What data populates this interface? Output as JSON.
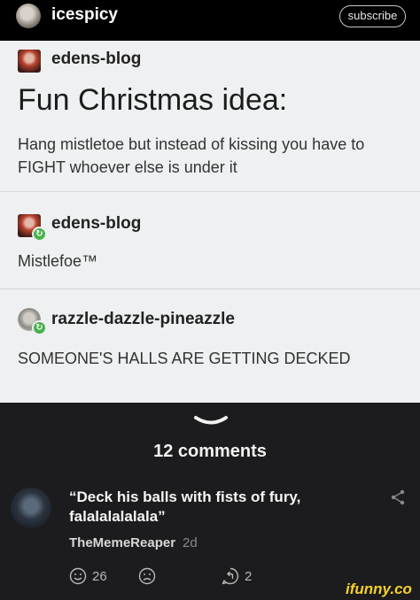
{
  "header": {
    "username": "icespicy",
    "subscribe_label": "subscribe"
  },
  "post": {
    "op_blog": "edens-blog",
    "title": "Fun Christmas idea:",
    "body": "Hang mistletoe but instead of kissing you have to FIGHT whoever else is under it",
    "reblogs": [
      {
        "blog": "edens-blog",
        "text": "Mistlefoe™"
      },
      {
        "blog": "razzle-dazzle-pineazzle",
        "text": "SOMEONE'S HALLS ARE GETTING DECKED"
      }
    ]
  },
  "comments": {
    "count_label": "12 comments",
    "top_comment": {
      "text": "“Deck his balls with fists of fury, falalalalalala”",
      "author": "TheMemeReaper",
      "time": "2d",
      "smile_count": "26",
      "reply_count": "2"
    }
  },
  "watermark": "ifunny.co",
  "icons": {
    "smile": "smile-icon",
    "frown": "frown-icon",
    "reply": "reply-icon",
    "share": "share-icon",
    "chevron": "chevron-down-icon",
    "reblog": "reblog-icon"
  },
  "colors": {
    "post_bg": "#eef0f1",
    "comments_bg": "#1c1c1e",
    "reblog_green": "#48b24e",
    "brand_yellow": "#f5d12b"
  }
}
